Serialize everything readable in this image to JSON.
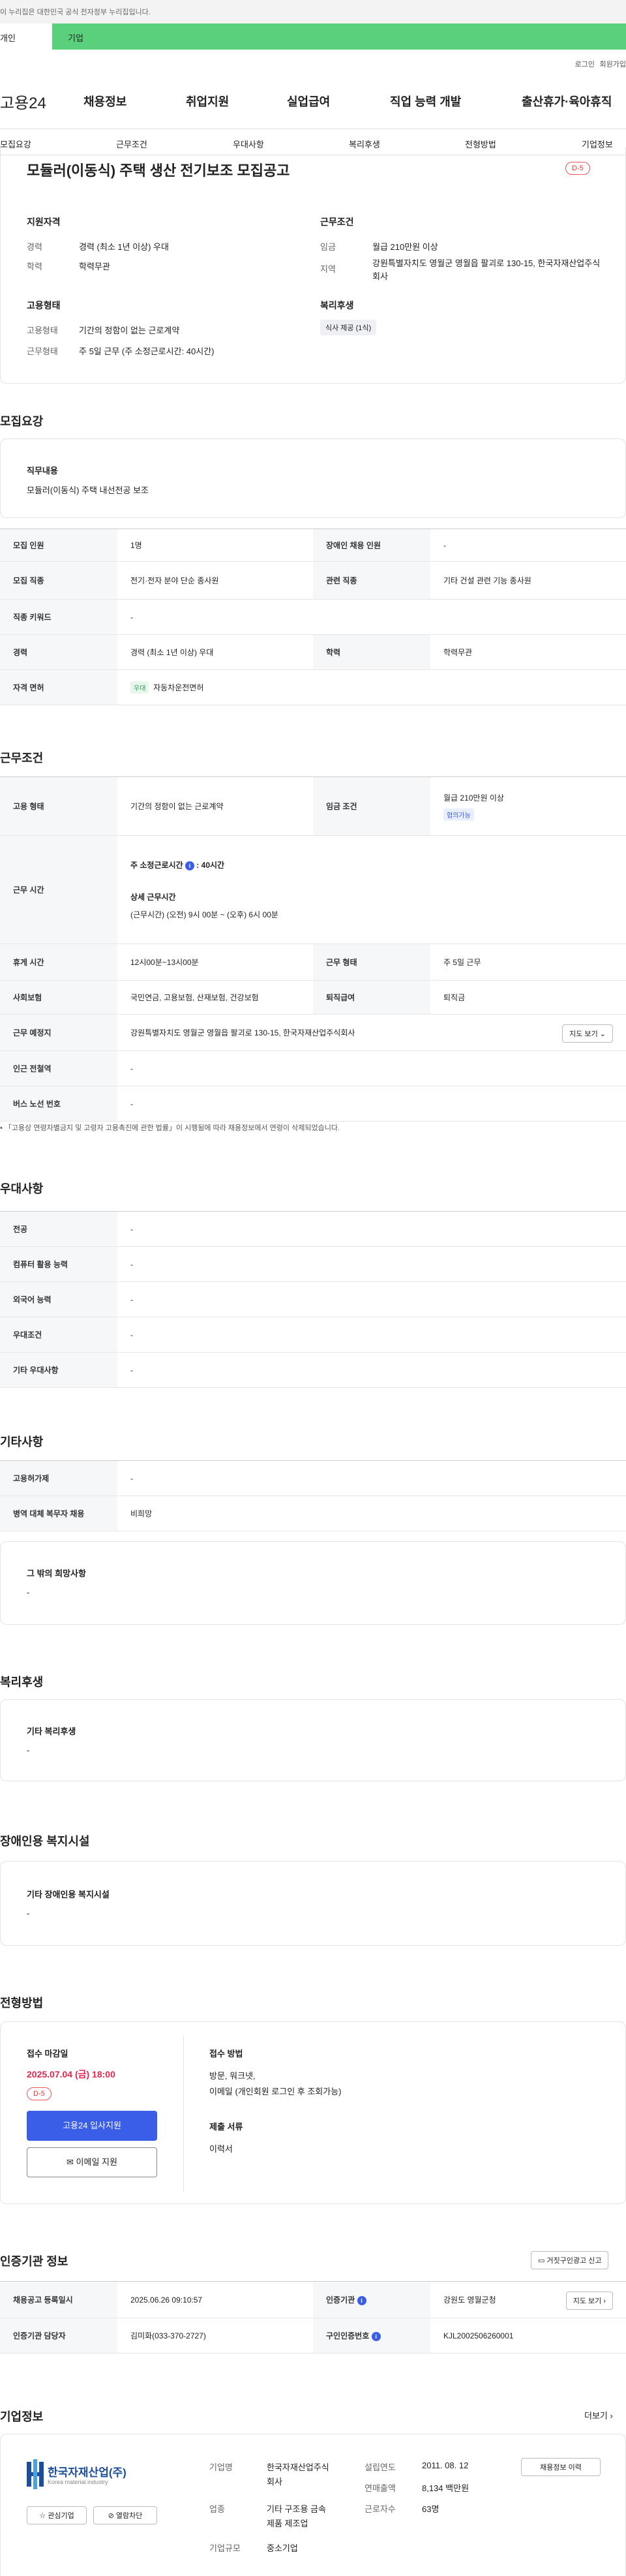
{
  "gov_bar": "이 누리집은 대한민국 공식 전자정부 누리집입니다.",
  "top_tabs": {
    "individual": "개인",
    "company": "기업"
  },
  "util": {
    "login": "로그인",
    "join": "회원가입"
  },
  "logo": "고용24",
  "gnb": [
    "채용정보",
    "취업지원",
    "실업급여",
    "직업 능력 개발",
    "출산휴가·육아휴직"
  ],
  "lnb": [
    "모집요강",
    "근무조건",
    "우대사항",
    "복리후생",
    "전형방법",
    "기업정보"
  ],
  "summary": {
    "title": "모듈러(이동식) 주택 생산 전기보조 모집공고",
    "dday": "D-5",
    "qual_title": "지원자격",
    "career_label": "경력",
    "career_value": "경력 (최소 1년 이상) 우대",
    "edu_label": "학력",
    "edu_value": "학력무관",
    "work_title": "근무조건",
    "wage_label": "임금",
    "wage_value": "월급 210만원 이상",
    "region_label": "지역",
    "region_value": "강원특별자치도 영월군 영월읍 팔괴로 130-15, 한국자재산업주식회사",
    "emp_title": "고용형태",
    "emp_label": "고용형태",
    "emp_value": "기간의 정함이 없는 근로계약",
    "worktype_label": "근무형태",
    "worktype_value": "주 5일 근무 (주 소정근로시간: 40시간)",
    "welfare_title": "복리후생",
    "welfare_chip": "식사 제공 (1식)"
  },
  "recruit": {
    "section_title": "모집요강",
    "job_desc_label": "직무내용",
    "job_desc_value": "모듈러(이동식) 주택 내선전공 보조",
    "rows": {
      "headcount_k": "모집 인원",
      "headcount_v": "1명",
      "disabled_k": "장애인 채용 인원",
      "disabled_v": "-",
      "job_k": "모집 직종",
      "job_v": "전기·전자 분야 단순 종사원",
      "related_k": "관련 직종",
      "related_v": "기타 건설 관련 기능 종사원",
      "keyword_k": "직종 키워드",
      "keyword_v": "-",
      "career_k": "경력",
      "career_v": "경력 (최소 1년 이상) 우대",
      "edu_k": "학력",
      "edu_v": "학력무관",
      "license_k": "자격 면허",
      "license_badge": "우대",
      "license_v": "자동차운전면허"
    }
  },
  "conditions": {
    "section_title": "근무조건",
    "emp_k": "고용 형태",
    "emp_v": "기간의 정함이 없는 근로계약",
    "wage_k": "임금 조건",
    "wage_v": "월급 210만원 이상",
    "wage_badge": "협의가능",
    "hours_k": "근무 시간",
    "hours_weekly_label": "주 소정근로시간",
    "hours_weekly_value": "40시간",
    "hours_detail_label": "상세 근무시간",
    "hours_detail_value": "(근무시간) (오전) 9시 00분 ~ (오후) 6시 00분",
    "rest_k": "휴게 시간",
    "rest_v": "12시00분~13시00분",
    "worktype_k": "근무 형태",
    "worktype_v": "주 5일 근무",
    "insurance_k": "사회보험",
    "insurance_v": "국민연금, 고용보험, 산재보험, 건강보험",
    "severance_k": "퇴직급여",
    "severance_v": "퇴직금",
    "location_k": "근무 예정지",
    "location_v": "강원특별자치도 영월군 영월읍 팔괴로 130-15, 한국자재산업주식회사",
    "map_btn": "지도 보기",
    "station_k": "인근 전철역",
    "station_v": "-",
    "bus_k": "버스 노선 번호",
    "bus_v": "-",
    "note": "「고용상 연령차별금지 및 고령자 고용촉진에 관한 법률」이 시행됨에 따라 채용정보에서 연령이 삭제되었습니다."
  },
  "preferences": {
    "section_title": "우대사항",
    "rows": [
      {
        "k": "전공",
        "v": "-"
      },
      {
        "k": "컴퓨터 활용 능력",
        "v": "-"
      },
      {
        "k": "외국어 능력",
        "v": "-"
      },
      {
        "k": "우대조건",
        "v": "-"
      },
      {
        "k": "기타 우대사항",
        "v": "-"
      }
    ]
  },
  "others": {
    "section_title": "기타사항",
    "rows": [
      {
        "k": "고용허가제",
        "v": "-"
      },
      {
        "k": "병역 대체 복무자 채용",
        "v": "비희망"
      }
    ],
    "wish_label": "그 밖의 희망사항",
    "wish_value": "-"
  },
  "welfare": {
    "section_title": "복리후생",
    "label": "기타 복리후생",
    "value": "-"
  },
  "disabled": {
    "section_title": "장애인용 복지시설",
    "label": "기타 장애인용 복지시설",
    "value": "-"
  },
  "selection": {
    "section_title": "전형방법",
    "deadline_label": "접수 마감일",
    "deadline_value": "2025.07.04 (금) 18:00",
    "dday": "D-5",
    "apply_btn": "고용24 입사지원",
    "email_btn": "이메일 지원",
    "method_label": "접수 방법",
    "method_line1": "방문, 워크넷,",
    "method_line2": "이메일 (개인회원 로그인 후 조회가능)",
    "docs_label": "제출 서류",
    "docs_value": "이력서"
  },
  "agency": {
    "section_title": "인증기관 정보",
    "report_btn": "거짓구인광고 신고",
    "posted_k": "채용공고 등록일시",
    "posted_v": "2025.06.26 09:10:57",
    "agency_k": "인증기관",
    "agency_v": "강원도 영월군청",
    "map_btn": "지도 보기",
    "manager_k": "인증기관 담당자",
    "manager_v": "김미화(033-370-2727)",
    "cert_k": "구인인증번호",
    "cert_v": "KJL2002506260001"
  },
  "company": {
    "section_title": "기업정보",
    "more": "더보기",
    "logo_name": "한국자재산업(주)",
    "logo_en": "Korea material industry",
    "fav_btn": "관심기업",
    "block_btn": "열람차단",
    "name_k": "기업명",
    "name_v1": "한국자재산업주식",
    "name_v2": "회사",
    "industry_k": "업종",
    "industry_v1": "기타 구조용 금속",
    "industry_v2": "제품 제조업",
    "size_k": "기업규모",
    "size_v": "중소기업",
    "founded_k": "설립연도",
    "founded_v": "2011. 08. 12",
    "sales_k": "연매출액",
    "sales_v": "8,134 백만원",
    "employees_k": "근로자수",
    "employees_v": "63명",
    "history_btn": "채용정보 이력"
  },
  "colors": {
    "accent": "#3b5ee8",
    "deadline": "#e2264d",
    "green_tab": "#5ad07c"
  }
}
